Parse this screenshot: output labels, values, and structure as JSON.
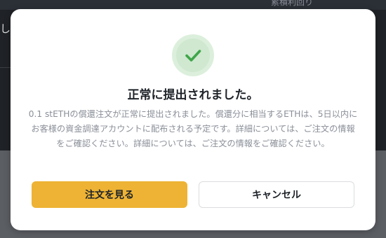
{
  "background": {
    "top_label": "累積利回り",
    "left_partial": "した"
  },
  "dialog": {
    "icon": "check-circle-icon",
    "title": "正常に提出されました。",
    "description": "0.1 stETHの償還注文が正常に提出されました。償還分に相当するETHは、5日以内にお客様の資金調達アカウントに配布される予定です。詳細については、ご注文の情報をご確認ください。詳細については、ご注文の情報をご確認ください。",
    "primary_button": "注文を見る",
    "secondary_button": "キャンセル"
  },
  "colors": {
    "accent": "#eeb334",
    "success": "#3fa64a",
    "success_bg": "#dcefdc"
  }
}
